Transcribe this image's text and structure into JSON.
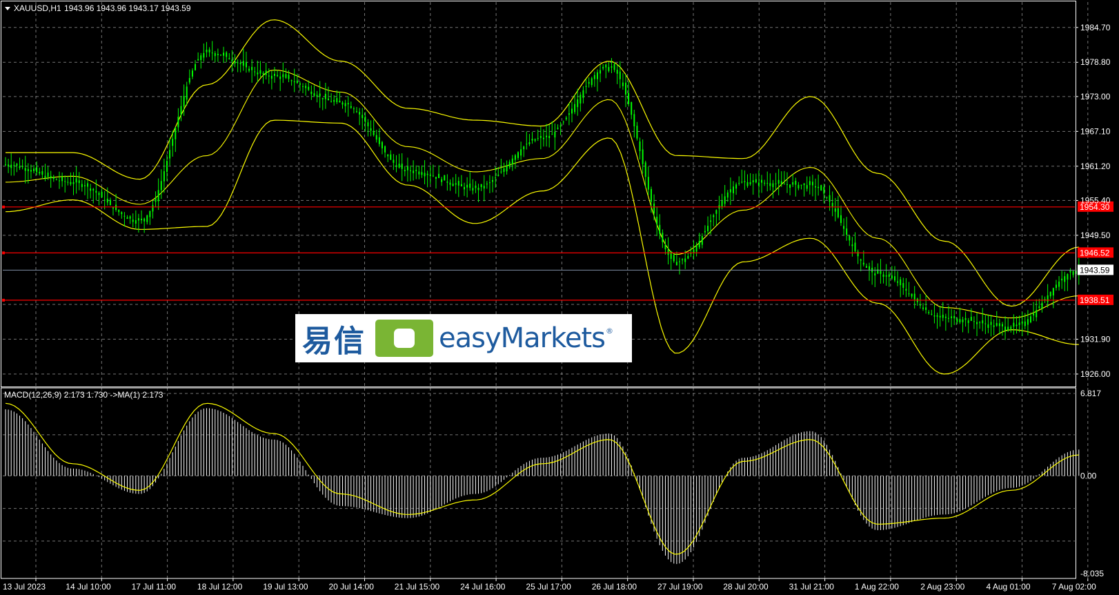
{
  "colors": {
    "background": "#000000",
    "grid": "#d8d8d8",
    "candles": "#00ff00",
    "bands": "#ffff00",
    "levels": "#ff0000",
    "macd_hist": "#ffffff",
    "signal": "#ffff00"
  },
  "header": {
    "dropdown_icon": "triangle-down-icon",
    "symbol": "XAUUSD,H1",
    "ohlc": "1943.96 1943.96 1943.17 1943.59"
  },
  "logo": {
    "text_cn": "易信",
    "text_en": "easyMarkets",
    "registered": "®"
  },
  "macd": {
    "label": "MACD(12,26,9) 2.173 1.730  ->MA(1) 2.173",
    "ticks": [
      "6.817",
      "0.00",
      "-8.035"
    ]
  },
  "price_axis": {
    "ticks": [
      "1984.70",
      "1978.80",
      "1973.00",
      "1967.10",
      "1961.20",
      "1955.40",
      "1949.50",
      "1931.90",
      "1926.00"
    ]
  },
  "levels": [
    {
      "value": 1954.3,
      "label": "1954.30"
    },
    {
      "value": 1946.52,
      "label": "1946.52"
    },
    {
      "value": 1938.51,
      "label": "1938.51"
    }
  ],
  "current_price": {
    "value": 1943.59,
    "label": "1943.59"
  },
  "time_axis": [
    "13 Jul 2023",
    "14 Jul 10:00",
    "17 Jul 11:00",
    "18 Jul 12:00",
    "19 Jul 13:00",
    "20 Jul 14:00",
    "21 Jul 15:00",
    "24 Jul 16:00",
    "25 Jul 17:00",
    "26 Jul 18:00",
    "27 Jul 19:00",
    "28 Jul 20:00",
    "31 Jul 21:00",
    "1 Aug 22:00",
    "2 Aug 23:00",
    "4 Aug 01:00",
    "7 Aug 02:00"
  ],
  "chart_data": [
    {
      "type": "line",
      "title": "XAUUSD,H1",
      "ylim": [
        1924.0,
        1989.0
      ],
      "series": [
        {
          "name": "XAUUSD,H1",
          "x": [
            "13 Jul 2023",
            "14 Jul 10:00",
            "17 Jul 11:00",
            "18 Jul 12:00",
            "19 Jul 13:00",
            "20 Jul 14:00",
            "21 Jul 15:00",
            "24 Jul 16:00",
            "25 Jul 17:00",
            "26 Jul 18:00",
            "27 Jul 19:00",
            "28 Jul 20:00",
            "31 Jul 21:00",
            "1 Aug 22:00",
            "2 Aug 23:00",
            "4 Aug 01:00",
            "7 Aug 02:00"
          ],
          "values": [
            1961.5,
            1958.5,
            1952.0,
            1980.5,
            1976.5,
            1972.0,
            1960.5,
            1957.5,
            1966.0,
            1978.0,
            1945.0,
            1958.5,
            1958.0,
            1943.0,
            1935.5,
            1934.0,
            1943.59
          ]
        },
        {
          "name": "",
          "x": [
            "13 Jul 2023",
            "14 Jul 10:00",
            "17 Jul 11:00",
            "18 Jul 12:00",
            "19 Jul 13:00",
            "20 Jul 14:00",
            "21 Jul 15:00",
            "24 Jul 16:00",
            "25 Jul 17:00",
            "26 Jul 18:00",
            "27 Jul 19:00",
            "28 Jul 20:00",
            "31 Jul 21:00",
            "1 Aug 22:00",
            "2 Aug 23:00",
            "4 Aug 01:00",
            "7 Aug 02:00"
          ],
          "values": [
            1963.5,
            1963.5,
            1959.0,
            1975.0,
            1986.0,
            1979.0,
            1971.0,
            1969.0,
            1968.0,
            1979.0,
            1963.0,
            1962.5,
            1973.0,
            1960.0,
            1948.5,
            1937.5,
            1947.5
          ]
        },
        {
          "name": "",
          "x": [
            "13 Jul 2023",
            "14 Jul 10:00",
            "17 Jul 11:00",
            "18 Jul 12:00",
            "19 Jul 13:00",
            "20 Jul 14:00",
            "21 Jul 15:00",
            "24 Jul 16:00",
            "25 Jul 17:00",
            "26 Jul 18:00",
            "27 Jul 19:00",
            "28 Jul 20:00",
            "31 Jul 21:00",
            "1 Aug 22:00",
            "2 Aug 23:00",
            "4 Aug 01:00",
            "7 Aug 02:00"
          ],
          "values": [
            1953.5,
            1955.5,
            1950.5,
            1951.0,
            1969.0,
            1968.5,
            1958.0,
            1951.5,
            1957.0,
            1966.0,
            1929.5,
            1945.0,
            1949.0,
            1938.0,
            1926.0,
            1933.5,
            1931.0
          ]
        }
      ]
    },
    {
      "type": "bar",
      "title": "MACD(12,26,9) 2.173 1.730  ->MA(1) 2.173",
      "ylim": [
        -8.035,
        6.817
      ],
      "categories": [
        "13 Jul 2023",
        "14 Jul 10:00",
        "17 Jul 11:00",
        "18 Jul 12:00",
        "19 Jul 13:00",
        "20 Jul 14:00",
        "21 Jul 15:00",
        "24 Jul 16:00",
        "25 Jul 17:00",
        "26 Jul 18:00",
        "27 Jul 19:00",
        "28 Jul 20:00",
        "31 Jul 21:00",
        "1 Aug 22:00",
        "2 Aug 23:00",
        "4 Aug 01:00",
        "7 Aug 02:00"
      ],
      "series": [
        {
          "name": "",
          "values": [
            5.5,
            0.6,
            -1.5,
            5.6,
            3.0,
            -2.5,
            -3.5,
            -1.5,
            1.5,
            3.5,
            -7.3,
            1.5,
            3.7,
            -4.5,
            -3.2,
            -1.0,
            2.173
          ]
        },
        {
          "name": "",
          "values": [
            6.0,
            1.0,
            -1.2,
            6.0,
            3.5,
            -1.5,
            -3.2,
            -2.0,
            1.0,
            3.0,
            -6.5,
            1.2,
            3.0,
            -4.0,
            -3.5,
            -1.2,
            1.73
          ]
        }
      ]
    }
  ]
}
